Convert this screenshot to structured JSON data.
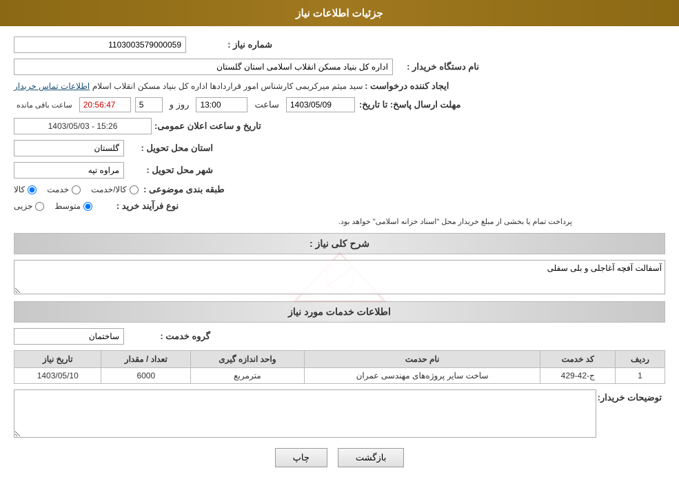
{
  "header": {
    "title": "جزئیات اطلاعات نیاز"
  },
  "fields": {
    "shomara_niaz_label": "شماره نیاز :",
    "shomara_niaz_value": "1103003579000059",
    "nam_dasgah_label": "نام دستگاه خریدار :",
    "nam_dasgah_value": "اداره کل بنیاد مسکن انقلاب اسلامی استان گلستان",
    "ijad_konande_label": "ایجاد کننده درخواست :",
    "ijad_konande_value": "سید میثم میرکریمی کارشناس امور قراردادها اداره کل بنیاد مسکن انقلاب اسلام",
    "contact_link": "اطلاعات تماس خریدار",
    "tarikh_label": "مهلت ارسال پاسخ: تا تاریخ:",
    "tarikh_date": "1403/05/09",
    "tarikh_time_label": "ساعت",
    "tarikh_time": "13:00",
    "tarikh_day_label": "روز و",
    "tarikh_day": "5",
    "tarikh_remaining_label": "ساعت باقی مانده",
    "tarikh_remaining": "20:56:47",
    "tarikh_aalan_label": "تاریخ و ساعت اعلان عمومی:",
    "tarikh_aalan_value": "1403/05/03 - 15:26",
    "ostan_label": "استان محل تحویل :",
    "ostan_value": "گلستان",
    "shahr_label": "شهر محل تحویل :",
    "shahr_value": "مراوه تپه",
    "tabaghebandi_label": "طبقه بندی موضوعی :",
    "tabaghebandi_options": [
      "کالا",
      "خدمت",
      "کالا/خدمت"
    ],
    "tabaghebandi_selected": "کالا",
    "nav_farayand_label": "نوع فرآیند خرید :",
    "nav_farayand_options": [
      "جزیی",
      "متوسط"
    ],
    "nav_farayand_selected": "متوسط",
    "nav_farayand_note": "پرداخت تمام یا بخشی از مبلغ خریدار محل \"اسناد خزانه اسلامی\" خواهد بود.",
    "sharh_label": "شرح کلی نیاز :",
    "sharh_value": "آسفالت آفچه آغاجلی و بلی سفلی",
    "service_section_title": "اطلاعات خدمات مورد نیاز",
    "gorohe_khedmat_label": "گروه خدمت :",
    "gorohe_khedmat_value": "ساختمان",
    "table_headers": [
      "ردیف",
      "کد خدمت",
      "نام حدمت",
      "واحد اندازه گیری",
      "تعداد / مقدار",
      "تاریخ نیاز"
    ],
    "table_rows": [
      {
        "radif": "1",
        "code": "ج-42-429",
        "name": "ساخت سایر پروژه‌های مهندسی عمران",
        "vahed": "مترمربع",
        "tedad": "6000",
        "tarikh": "1403/05/10"
      }
    ],
    "tozihat_label": "توضیحات خریدار:",
    "tozihat_value": "",
    "btn_print": "چاپ",
    "btn_back": "بازگشت"
  }
}
